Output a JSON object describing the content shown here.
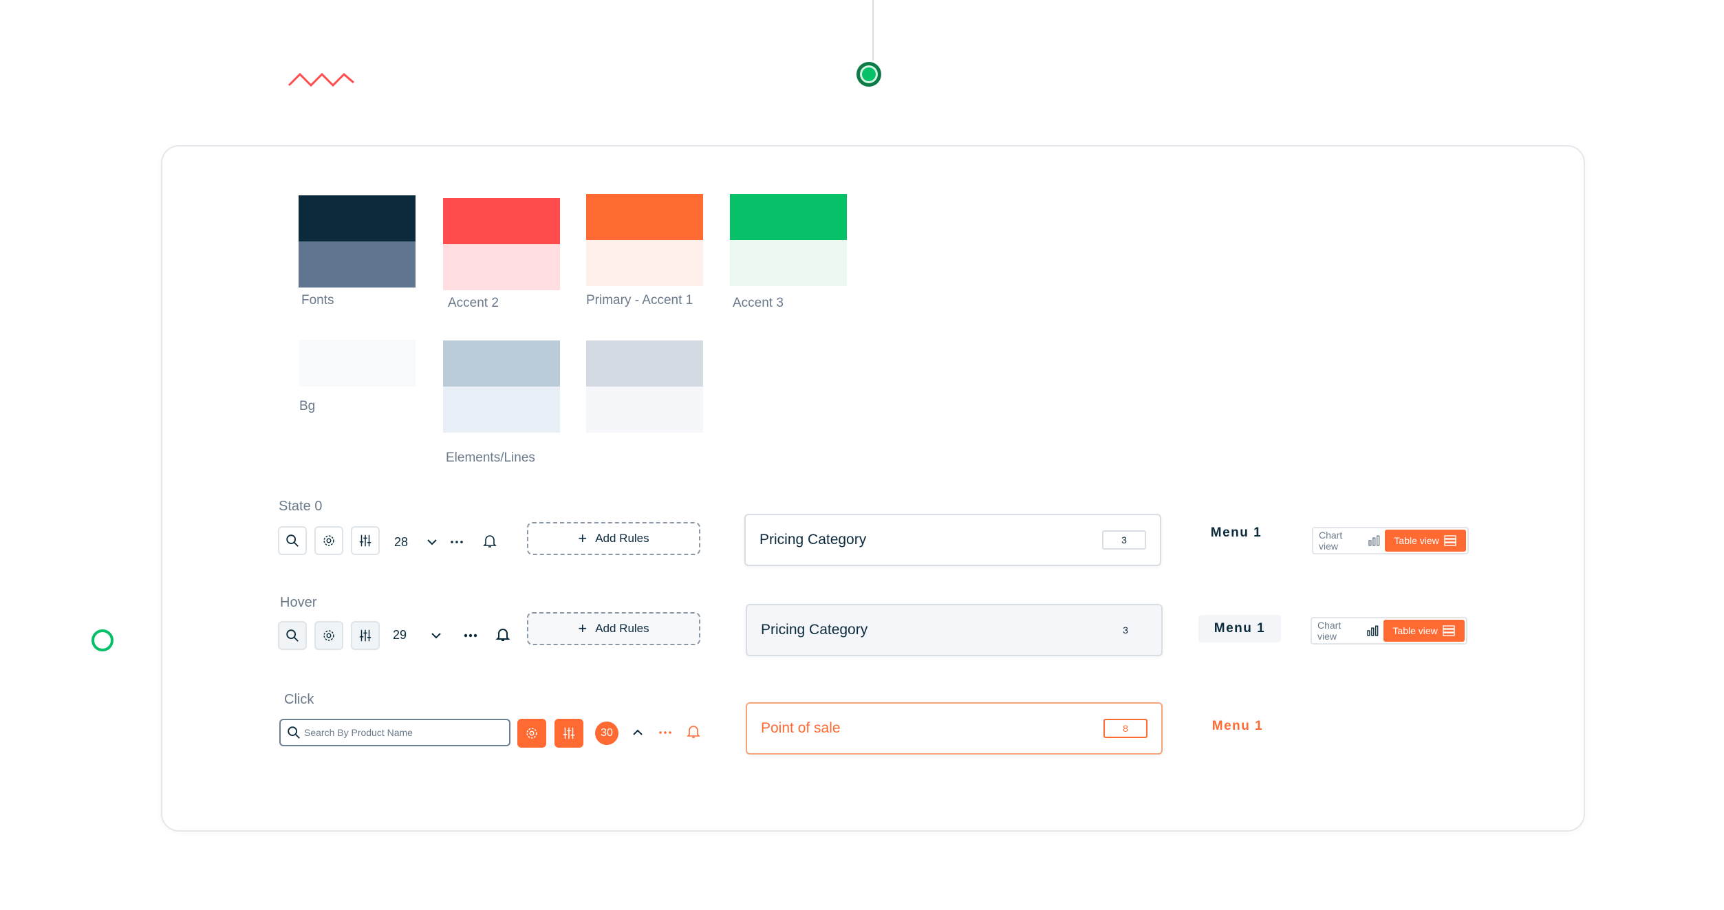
{
  "colors": {
    "accent_orange": "#ff6a33",
    "navy": "#0b2a3c",
    "green": "#06c167"
  },
  "palette": {
    "row1": [
      {
        "label": "Fonts",
        "top": "#0b2a3c",
        "bottom": "#5f7590"
      },
      {
        "label": "Accent 2",
        "top": "#ff4c4c",
        "bottom": "#ffdde0"
      },
      {
        "label": "Primary - Accent 1",
        "top": "#ff6a33",
        "bottom": "#fff0eb"
      },
      {
        "label": "Accent 3",
        "top": "#06c167",
        "bottom": "#eaf8f1"
      }
    ],
    "row2": [
      {
        "label": "Bg",
        "top": "#f9fafc",
        "bottom": "#f9fafc"
      },
      {
        "label": "Elements/Lines",
        "top": "#bccbd8",
        "bottom": "#e8eff6"
      },
      {
        "label": "",
        "top": "#d3dae2",
        "bottom": "#f5f7fa"
      }
    ]
  },
  "states": {
    "state0": {
      "label": "State 0",
      "count": "28",
      "add_rules": "Add Rules",
      "pricing_title": "Pricing Category",
      "pricing_value": "3",
      "menu": "Menu 1",
      "chart_view": "Chart view",
      "table_view": "Table view"
    },
    "hover": {
      "label": "Hover",
      "count": "29",
      "add_rules": "Add Rules",
      "pricing_title": "Pricing Category",
      "pricing_value": "3",
      "menu": "Menu 1",
      "chart_view": "Chart view",
      "table_view": "Table view"
    },
    "click": {
      "label": "Click",
      "search_placeholder": "Search By Product Name",
      "count": "30",
      "pricing_title": "Point of sale",
      "pricing_value": "8",
      "menu": "Menu 1"
    }
  },
  "icons": {
    "search": "search-icon",
    "settings": "gear-icon",
    "filters": "sliders-icon",
    "more": "more-dots-icon",
    "notifications": "bell-icon",
    "chart": "bar-chart-icon",
    "table": "table-list-icon"
  }
}
